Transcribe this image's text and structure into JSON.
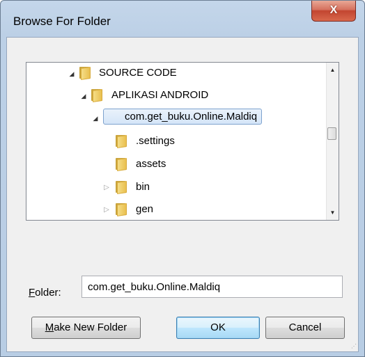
{
  "window": {
    "title": "Browse For Folder",
    "close_glyph": "X"
  },
  "tree": {
    "items": [
      {
        "label": "SOURCE CODE",
        "expander": "expanded",
        "level": 0
      },
      {
        "label": "APLIKASI ANDROID",
        "expander": "expanded",
        "level": 1
      },
      {
        "label": "com.get_buku.Online.Maldiq",
        "expander": "expanded",
        "level": 2,
        "selected": true
      },
      {
        "label": ".settings",
        "expander": "none",
        "level": 3
      },
      {
        "label": "assets",
        "expander": "none",
        "level": 3
      },
      {
        "label": "bin",
        "expander": "collapsed",
        "level": 3
      },
      {
        "label": "gen",
        "expander": "collapsed",
        "level": 3
      }
    ],
    "scrollbar": {
      "up_glyph": "▲",
      "down_glyph": "▼",
      "position": 0.45
    }
  },
  "folder_field": {
    "label_first": "F",
    "label_rest": "older:",
    "value": "com.get_buku.Online.Maldiq"
  },
  "buttons": {
    "make_new_folder_first": "M",
    "make_new_folder_rest": "ake New Folder",
    "ok": "OK",
    "cancel": "Cancel"
  },
  "icons": {
    "folder": "folder-icon",
    "expander_open": "expander-open-icon",
    "expander_closed": "expander-closed-icon"
  },
  "colors": {
    "selection_border": "#7da2ce",
    "close_button": "#c24530",
    "folder_yellow": "#e8bd4b"
  }
}
